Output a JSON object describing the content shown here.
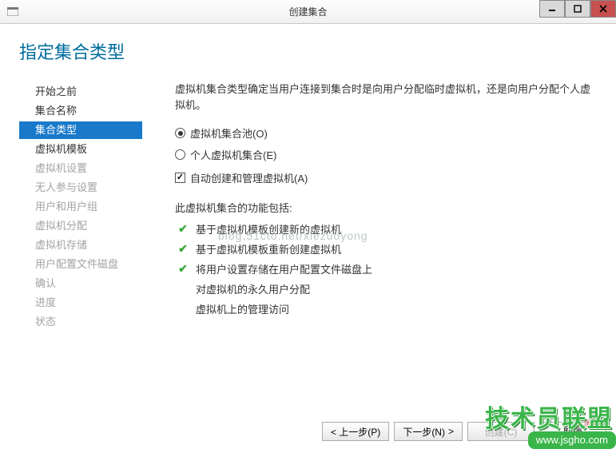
{
  "window": {
    "title": "创建集合"
  },
  "heading": "指定集合类型",
  "sidebar": {
    "items": [
      {
        "label": "开始之前",
        "state": "normal"
      },
      {
        "label": "集合名称",
        "state": "normal"
      },
      {
        "label": "集合类型",
        "state": "selected"
      },
      {
        "label": "虚拟机模板",
        "state": "normal"
      },
      {
        "label": "虚拟机设置",
        "state": "disabled"
      },
      {
        "label": "无人参与设置",
        "state": "disabled"
      },
      {
        "label": "用户和用户组",
        "state": "disabled"
      },
      {
        "label": "虚拟机分配",
        "state": "disabled"
      },
      {
        "label": "虚拟机存储",
        "state": "disabled"
      },
      {
        "label": "用户配置文件磁盘",
        "state": "disabled"
      },
      {
        "label": "确认",
        "state": "disabled"
      },
      {
        "label": "进度",
        "state": "disabled"
      },
      {
        "label": "状态",
        "state": "disabled"
      }
    ]
  },
  "main": {
    "description": "虚拟机集合类型确定当用户连接到集合时是向用户分配临时虚拟机，还是向用户分配个人虚拟机。",
    "radios": [
      {
        "label": "虚拟机集合池(O)",
        "checked": true
      },
      {
        "label": "个人虚拟机集合(E)",
        "checked": false
      }
    ],
    "checkbox": {
      "label": "自动创建和管理虚拟机(A)",
      "checked": true
    },
    "features_header": "此虚拟机集合的功能包括:",
    "features": [
      {
        "text": "基于虚拟机模板创建新的虚拟机",
        "check": true
      },
      {
        "text": "基于虚拟机模板重新创建虚拟机",
        "check": true
      },
      {
        "text": "将用户设置存储在用户配置文件磁盘上",
        "check": true
      },
      {
        "text": "对虚拟机的永久用户分配",
        "check": false
      },
      {
        "text": "虚拟机上的管理访问",
        "check": false
      }
    ]
  },
  "footer": {
    "prev": "< 上一步(P)",
    "next_label": "下一步(N)",
    "next_arrow": ">",
    "create": "创建(C)",
    "cancel": "取消"
  },
  "watermark": "blog.51cto.net/xiezuoyong",
  "logo": {
    "text": "技术员联盟",
    "url": "www.jsgho.com"
  },
  "redtag": "红黑联盟"
}
